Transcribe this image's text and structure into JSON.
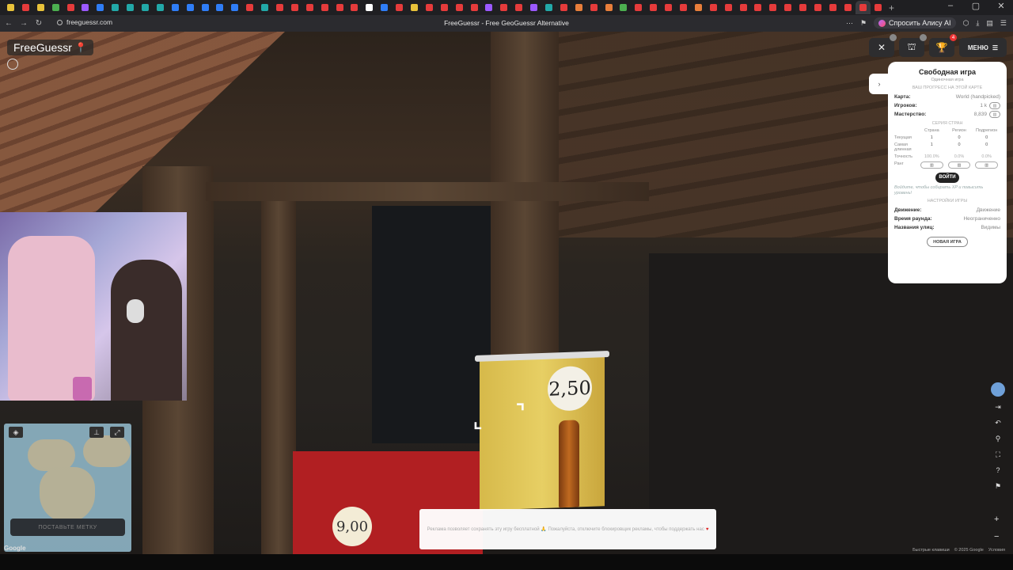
{
  "browser": {
    "url": "freeguessr.com",
    "page_title": "FreeGuessr - Free GeoGuessr Alternative",
    "ask_alisa": "Спросить Алису AI",
    "tab_colors": [
      "#e8c23a",
      "#e53b3b",
      "#e8c23a",
      "#4caf50",
      "#e53b3b",
      "#9b59ff",
      "#2f7df6",
      "#22a8a8",
      "#22a8a8",
      "#22a8a8",
      "#22a8a8",
      "#2f7df6",
      "#2f7df6",
      "#2f7df6",
      "#2f7df6",
      "#2f7df6",
      "#e53b3b",
      "#22a8a8",
      "#e53b3b",
      "#e53b3b",
      "#e53b3b",
      "#e53b3b",
      "#e53b3b",
      "#e53b3b",
      "#ffffff",
      "#2f7df6",
      "#e53b3b",
      "#e8c23a",
      "#e53b3b",
      "#e53b3b",
      "#e53b3b",
      "#e53b3b",
      "#9b59ff",
      "#e53b3b",
      "#e53b3b",
      "#9b59ff",
      "#22a8a8",
      "#e53b3b",
      "#e87e3b",
      "#e53b3b",
      "#e87e3b",
      "#4caf50",
      "#e53b3b",
      "#e53b3b",
      "#e53b3b",
      "#e53b3b",
      "#e87e3b",
      "#e53b3b",
      "#e53b3b",
      "#e53b3b",
      "#e53b3b",
      "#e53b3b",
      "#e53b3b",
      "#e53b3b",
      "#e53b3b",
      "#e53b3b",
      "#e53b3b",
      "#e53b3b",
      "#e53b3b"
    ]
  },
  "logo": {
    "text": "FreeGuessr"
  },
  "scene": {
    "sign_price": "2,50",
    "panel_price": "9,00"
  },
  "topbar": {
    "menu_label": "МЕНЮ",
    "notif_count": "4"
  },
  "panel": {
    "title": "Свободная игра",
    "subtitle": "Одиночная игра",
    "progress_header": "ВАШ ПРОГРЕСС НА ЭТОЙ КАРТЕ",
    "map_label": "Карта:",
    "map_value": "World (handpicked)",
    "players_label": "Игроков:",
    "players_value": "1 k",
    "mastery_label": "Мастерство:",
    "mastery_value": "8,839",
    "streak_header": "СЕРИЯ СТРАН",
    "col_country": "Страна",
    "col_region": "Регион",
    "col_subregion": "Подрегион",
    "current_label": "Текущая",
    "current": [
      "1",
      "0",
      "0"
    ],
    "longest_label": "Самая длинная",
    "longest": [
      "1",
      "0",
      "0"
    ],
    "accuracy_label": "Точность",
    "accuracy": [
      "100.0%",
      "0.0%",
      "0.0%"
    ],
    "rank_label": "Ранг",
    "login_label": "ВОЙТИ",
    "login_hint": "Войдите, чтобы собирать XP и повысить уровень!",
    "settings_header": "НАСТРОЙКИ ИГРЫ",
    "movement_label": "Движение:",
    "movement_value": "Движение",
    "round_time_label": "Время раунда:",
    "round_time_value": "Неограниченно",
    "street_names_label": "Названия улиц:",
    "street_names_value": "Видимы",
    "new_game_label": "НОВАЯ ИГРА"
  },
  "minimap": {
    "guess_button": "ПОСТАВЬТЕ МЕТКУ",
    "attribution": "Google"
  },
  "ad": {
    "text": "Реклама позволяет сохранять эту игру бесплатной 🙏 Пожалуйста, отключите блокировщик рекламы, чтобы поддержать нас"
  },
  "footer": {
    "report": "Быстрые клавиши",
    "copyright": "© 2025 Google",
    "terms": "Условия"
  }
}
